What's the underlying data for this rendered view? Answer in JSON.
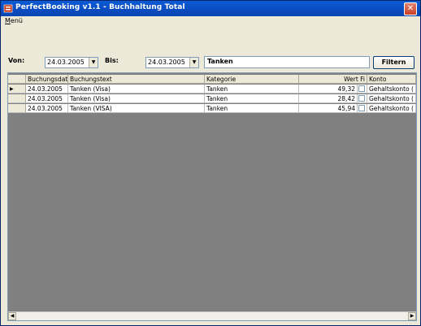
{
  "window": {
    "title": "PerfectBooking v1.1 - Buchhaltung Total",
    "close_symbol": "✕"
  },
  "menu": {
    "item_underlined": "M",
    "item_rest": "enü"
  },
  "filter": {
    "from_label": "Von:",
    "from_date": "24.03.2005",
    "to_label": "Bis:",
    "to_date": "24.03.2005",
    "search_value": "Tanken",
    "filter_button": "Filtern",
    "dropdown_symbol": "▼"
  },
  "grid": {
    "columns": [
      "Buchungsdat",
      "Buchungstext",
      "Kategorie",
      "Wert Fi",
      "Konto"
    ],
    "current_row_marker": "▶",
    "rows": [
      {
        "date": "24.03.2005",
        "text": "Tanken (Visa)",
        "category": "Tanken",
        "value": "49,32",
        "checked": false,
        "account": "Gehaltskonto ("
      },
      {
        "date": "24.03.2005",
        "text": "Tanken (Visa)",
        "category": "Tanken",
        "value": "28,42",
        "checked": false,
        "account": "Gehaltskonto ("
      },
      {
        "date": "24.03.2005",
        "text": "Tanken (VISA)",
        "category": "Tanken",
        "value": "45,94",
        "checked": false,
        "account": "Gehaltskonto ("
      }
    ],
    "scroll_left": "◀",
    "scroll_right": "▶"
  },
  "colors": {
    "titlebar": "#0a4bc0",
    "grid_background": "#808080",
    "window_face": "#ece9d8"
  }
}
